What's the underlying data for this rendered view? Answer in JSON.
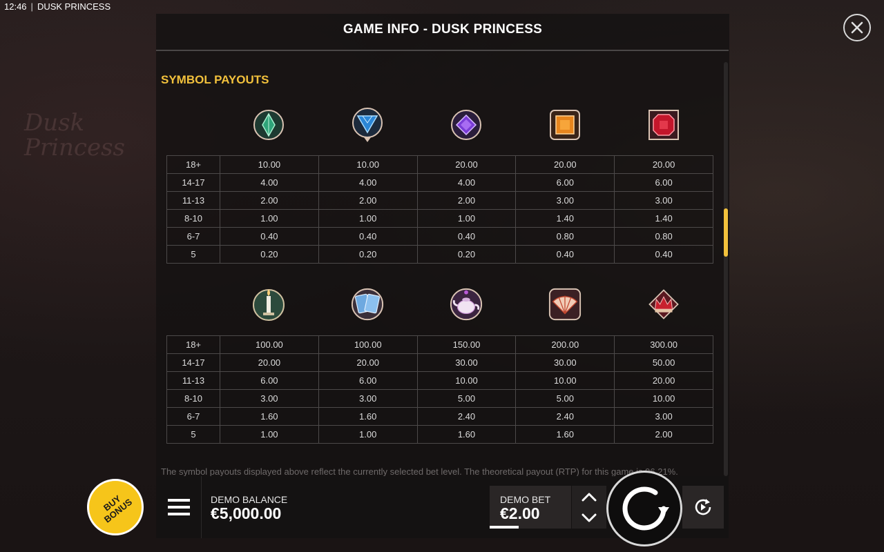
{
  "status": {
    "time": "12:46",
    "separator": "|",
    "app_name": "DUSK PRINCESS"
  },
  "background": {
    "logo_text_line1": "Dusk",
    "logo_text_line2": "Princess"
  },
  "dialog": {
    "title": "GAME INFO - DUSK PRINCESS",
    "section_title": "SYMBOL PAYOUTS",
    "close_icon": "close-icon",
    "scroll_position": 0.35
  },
  "symbols_low": [
    "green-gem-icon",
    "blue-gem-icon",
    "purple-gem-icon",
    "orange-gem-icon",
    "red-gem-icon"
  ],
  "symbols_high": [
    "candle-icon",
    "cards-icon",
    "teapot-icon",
    "fan-icon",
    "crown-icon"
  ],
  "payouts_low": [
    [
      "18+",
      "10.00",
      "10.00",
      "20.00",
      "20.00",
      "20.00"
    ],
    [
      "14-17",
      "4.00",
      "4.00",
      "4.00",
      "6.00",
      "6.00"
    ],
    [
      "11-13",
      "2.00",
      "2.00",
      "2.00",
      "3.00",
      "3.00"
    ],
    [
      "8-10",
      "1.00",
      "1.00",
      "1.00",
      "1.40",
      "1.40"
    ],
    [
      "6-7",
      "0.40",
      "0.40",
      "0.40",
      "0.80",
      "0.80"
    ],
    [
      "5",
      "0.20",
      "0.20",
      "0.20",
      "0.40",
      "0.40"
    ]
  ],
  "payouts_high": [
    [
      "18+",
      "100.00",
      "100.00",
      "150.00",
      "200.00",
      "300.00"
    ],
    [
      "14-17",
      "20.00",
      "20.00",
      "30.00",
      "30.00",
      "50.00"
    ],
    [
      "11-13",
      "6.00",
      "6.00",
      "10.00",
      "10.00",
      "20.00"
    ],
    [
      "8-10",
      "3.00",
      "3.00",
      "5.00",
      "5.00",
      "10.00"
    ],
    [
      "6-7",
      "1.60",
      "1.60",
      "2.40",
      "2.40",
      "3.00"
    ],
    [
      "5",
      "1.00",
      "1.00",
      "1.60",
      "1.60",
      "2.00"
    ]
  ],
  "disclaimer": "The symbol payouts displayed above reflect the currently selected bet level. The theoretical payout (RTP) for this game is 96.21%.",
  "controls": {
    "buy_bonus_line1": "BUY",
    "buy_bonus_line2": "BONUS",
    "balance_label": "DEMO BALANCE",
    "balance_value": "€5,000.00",
    "bet_label": "DEMO BET",
    "bet_value": "€2.00",
    "bet_level_fraction": 0.25
  },
  "colors": {
    "accent": "#f2c13c",
    "buy_bonus": "#f6c51a",
    "text": "#e6e6e6"
  }
}
